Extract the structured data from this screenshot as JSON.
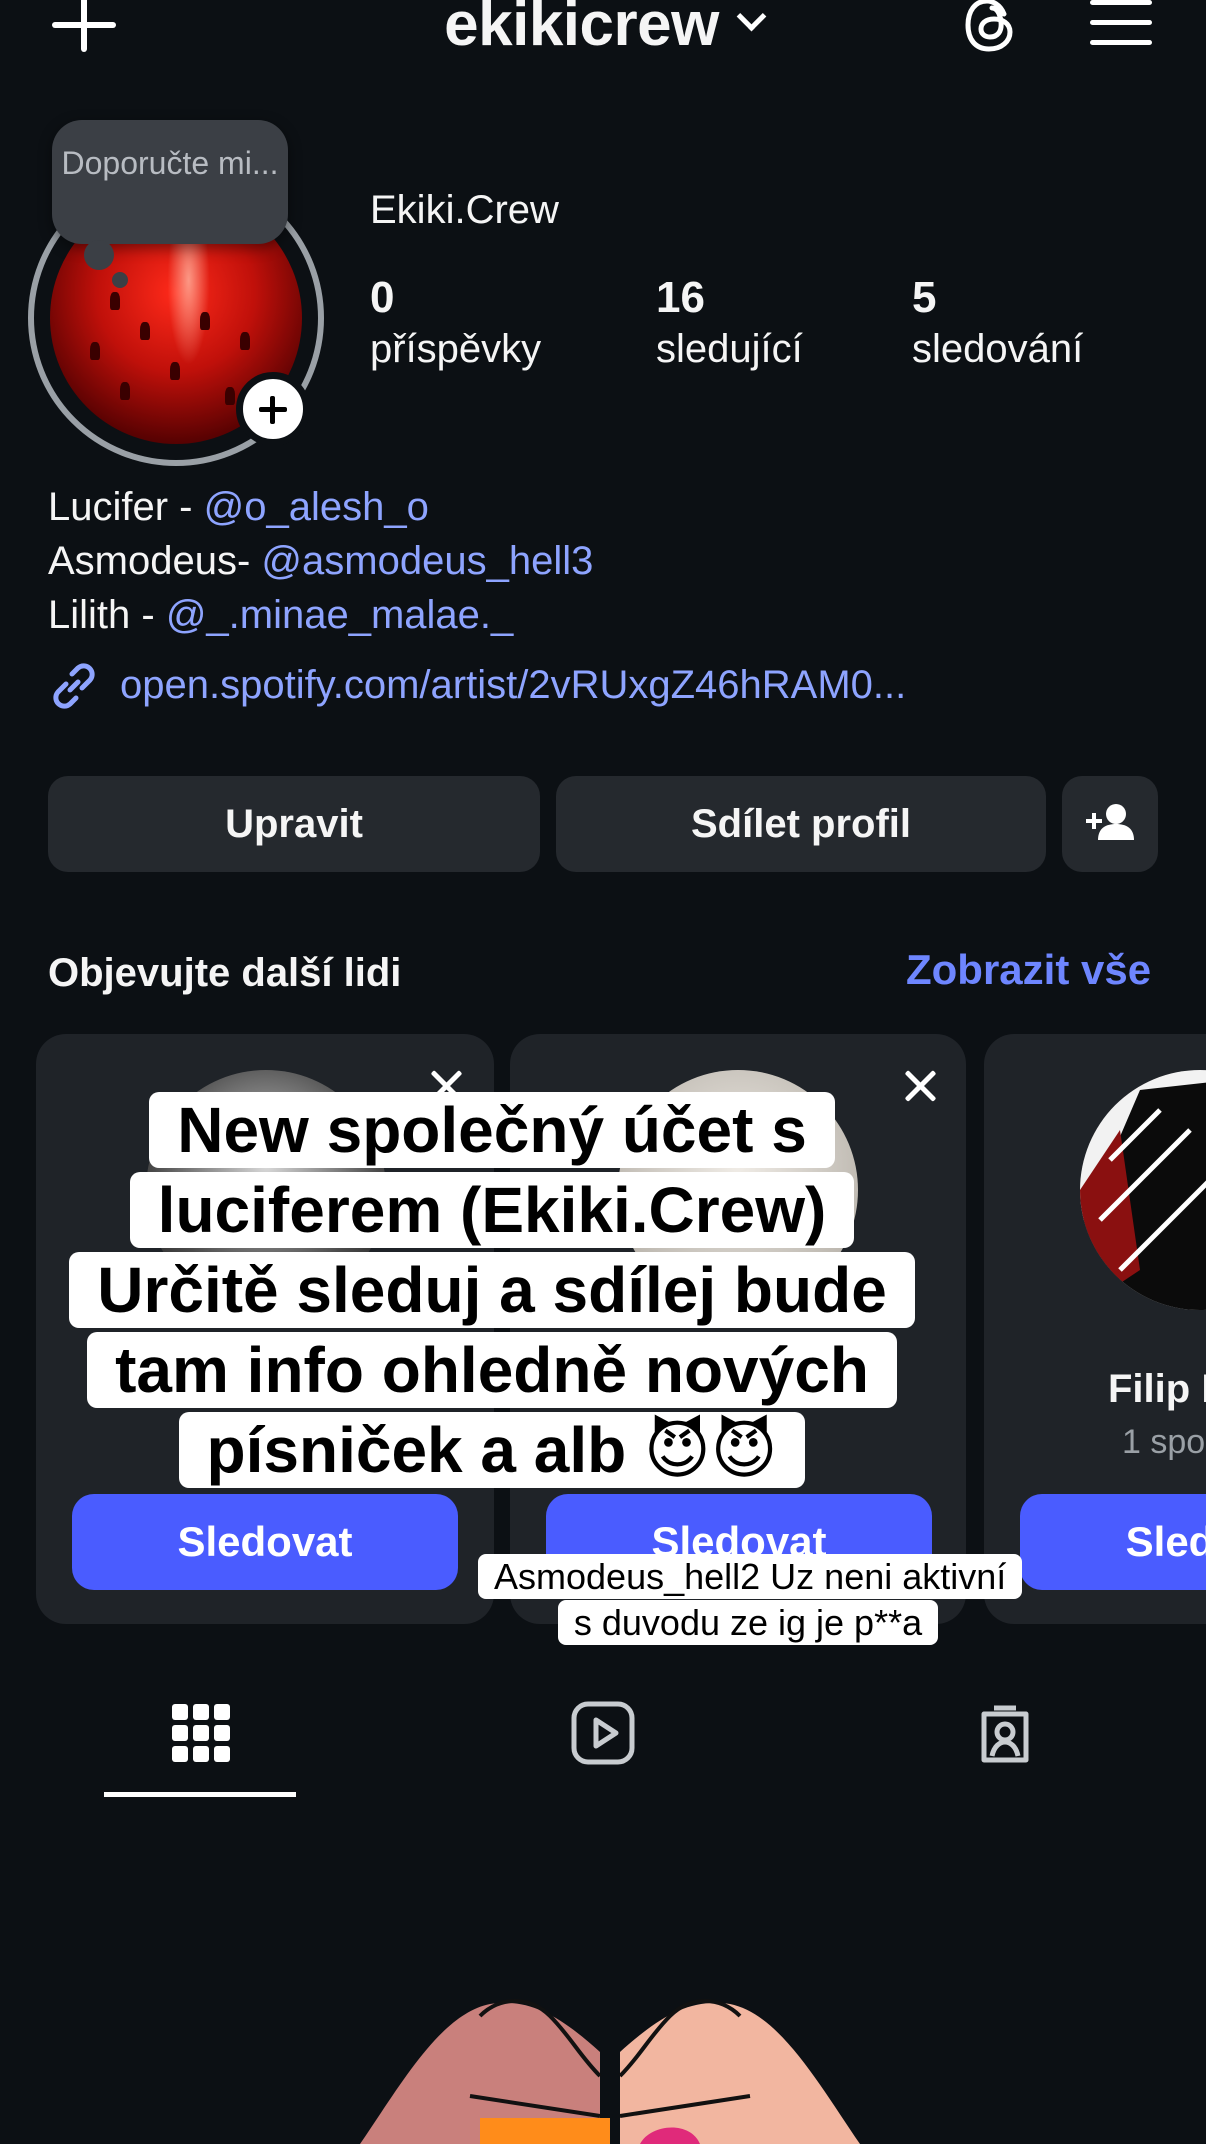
{
  "header": {
    "username": "ekikicrew"
  },
  "note": {
    "text": "Doporučte mi..."
  },
  "profile": {
    "display_name": "Ekiki.Crew",
    "stats": [
      {
        "value": "0",
        "label": "příspěvky"
      },
      {
        "value": "16",
        "label": "sledující"
      },
      {
        "value": "5",
        "label": "sledování"
      }
    ]
  },
  "bio": {
    "lines": [
      {
        "prefix": "Lucifer - ",
        "mention": "@o_alesh_o"
      },
      {
        "prefix": "Asmodeus- ",
        "mention": "@asmodeus_hell3"
      },
      {
        "prefix": "Lilith - ",
        "mention": "@_.minae_malae._"
      }
    ],
    "link": "open.spotify.com/artist/2vRUxgZ46hRAM0..."
  },
  "actions": {
    "edit_label": "Upravit",
    "share_label": "Sdílet profil"
  },
  "discover": {
    "title": "Objevujte další lidi",
    "see_all": "Zobrazit vše",
    "cards": [
      {
        "name": "",
        "follow_label": "Sledovat"
      },
      {
        "name": "",
        "follow_label": "Sledovat"
      },
      {
        "name": "Filip I",
        "sub": "1 spo",
        "follow_label": "Sled"
      }
    ]
  },
  "captions": {
    "big": "New společný účet s luciferem (Ekiki.Crew) Určitě sleduj a sdílej bude tam info ohledně nových písniček a alb 😈😈",
    "small": "Asmodeus_hell2 Uz neni aktivní s duvodu ze ig je p**a"
  },
  "colors": {
    "background": "#0c1014",
    "accent": "#4a5cff",
    "link": "#8ea4ff"
  }
}
